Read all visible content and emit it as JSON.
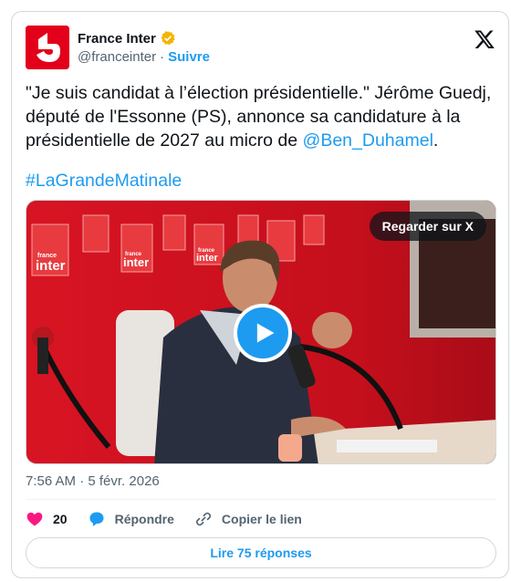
{
  "account": {
    "name": "France Inter",
    "handle": "@franceinter",
    "separator": "·",
    "follow_label": "Suivre",
    "verified_badge_color": "#f4b400",
    "brand_color": "#e2001a"
  },
  "tweet": {
    "line1": "\"Je suis candidat à l’élection présidentielle.\" Jérôme Guedj,",
    "line2": "député de l'Essonne (PS), annonce sa candidature à la",
    "line3_prefix": "présidentielle de 2027 au micro de ",
    "mention": "@Ben_Duhamel",
    "line3_suffix": ".",
    "hashtag": "#LaGrandeMatinale",
    "link_color": "#1d9bf0"
  },
  "media": {
    "watch_label": "Regarder sur X",
    "logo_text_top": "france",
    "logo_text_bottom": "inter",
    "play_icon": "play-icon"
  },
  "meta": {
    "timestamp": "7:56 AM · 5 févr. 2026"
  },
  "actions": {
    "like_count": "20",
    "reply_label": "Répondre",
    "copy_label": "Copier le lien",
    "like_color": "#f91880",
    "reply_icon_color": "#1d9bf0"
  },
  "replies_button": {
    "label": "Lire 75 réponses"
  }
}
